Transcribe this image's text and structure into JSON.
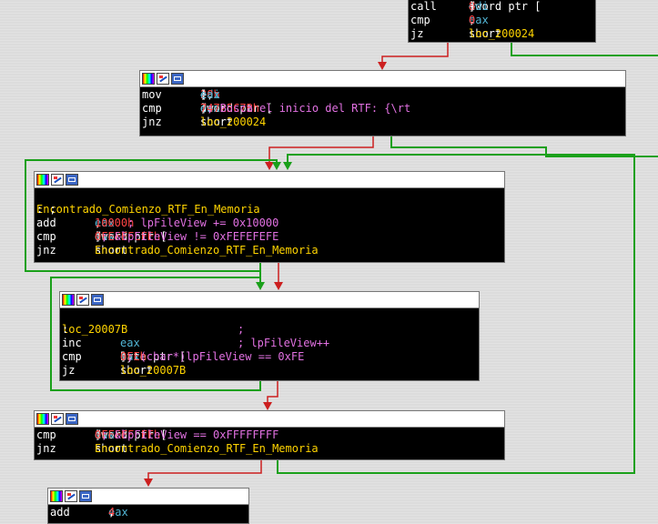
{
  "colors": {
    "background": "#dcdcdc",
    "edge_true": "#1aa01a",
    "edge_false": "#cc1f1f",
    "mnemonic": "#ffffff",
    "register": "#52b6d6",
    "number": "#ff4545",
    "label": "#ffd400",
    "comment": "#e271e2"
  },
  "toolbar_icons": [
    "color-icon",
    "graph-icon",
    "group-icon"
  ],
  "block0": {
    "lines": [
      {
        "mn": "call",
        "a": "dword ptr [",
        "b": "edi",
        "c": "+",
        "d": "8",
        "e": "]"
      },
      {
        "mn": "cmp",
        "a": "eax",
        "b": ", ",
        "c": "0"
      },
      {
        "mn": "jz",
        "a": "short ",
        "b": "loc_200024"
      }
    ]
  },
  "block1": {
    "lines": [
      {
        "mn": "mov",
        "a": "[",
        "b": "edi",
        "c": "+",
        "d": "20h",
        "e": "], ",
        "f": "eax"
      },
      {
        "mn": "cmp",
        "a": "dword ptr [",
        "b": "eax",
        "c": "], ",
        "d": "74725C7Bh",
        "e": " ; Busca el inicio del RTF: {\\rt"
      },
      {
        "mn": "jnz",
        "a": "short ",
        "b": "loc_200024"
      }
    ]
  },
  "block2": {
    "label": "Encontrado_Comienzo_RTF_En_Memoria",
    "label_suffix": ": ;",
    "lines": [
      {
        "mn": "add",
        "a": "eax",
        "b": ", ",
        "c": "10000h",
        "d": "     ; lpFileView += 0x10000"
      },
      {
        "mn": "cmp",
        "a": "dword ptr [",
        "b": "eax",
        "c": "], ",
        "d": "0FEFEFEFEh",
        "e": " ; &lpFileView != 0xFEFEFEFE"
      },
      {
        "mn": "jnz",
        "a": "short ",
        "b": "Encontrado_Comienzo_RTF_En_Memoria"
      }
    ]
  },
  "block3": {
    "label": "loc_20007B",
    "label_suffix": ":",
    "label_comment": ";",
    "lines": [
      {
        "mn": "inc",
        "a": "eax",
        "d": "; lpFileView++"
      },
      {
        "mn": "cmp",
        "a": "byte ptr [",
        "b": "eax",
        "c": "], ",
        "d": "0FEh",
        "e": " ; (char*)lpFileView == 0xFE"
      },
      {
        "mn": "jz",
        "a": "short ",
        "b": "loc_20007B"
      }
    ]
  },
  "block4": {
    "lines": [
      {
        "mn": "cmp",
        "a": "dword ptr [",
        "b": "eax",
        "c": "], ",
        "d": "0FFFFFFFFh",
        "e": " ; &lpFileView == 0xFFFFFFFF"
      },
      {
        "mn": "jnz",
        "a": "short ",
        "b": "Encontrado_Comienzo_RTF_En_Memoria"
      }
    ]
  },
  "block5": {
    "lines": [
      {
        "mn": "add",
        "a": "eax",
        "b": ", ",
        "c": "4"
      }
    ]
  }
}
